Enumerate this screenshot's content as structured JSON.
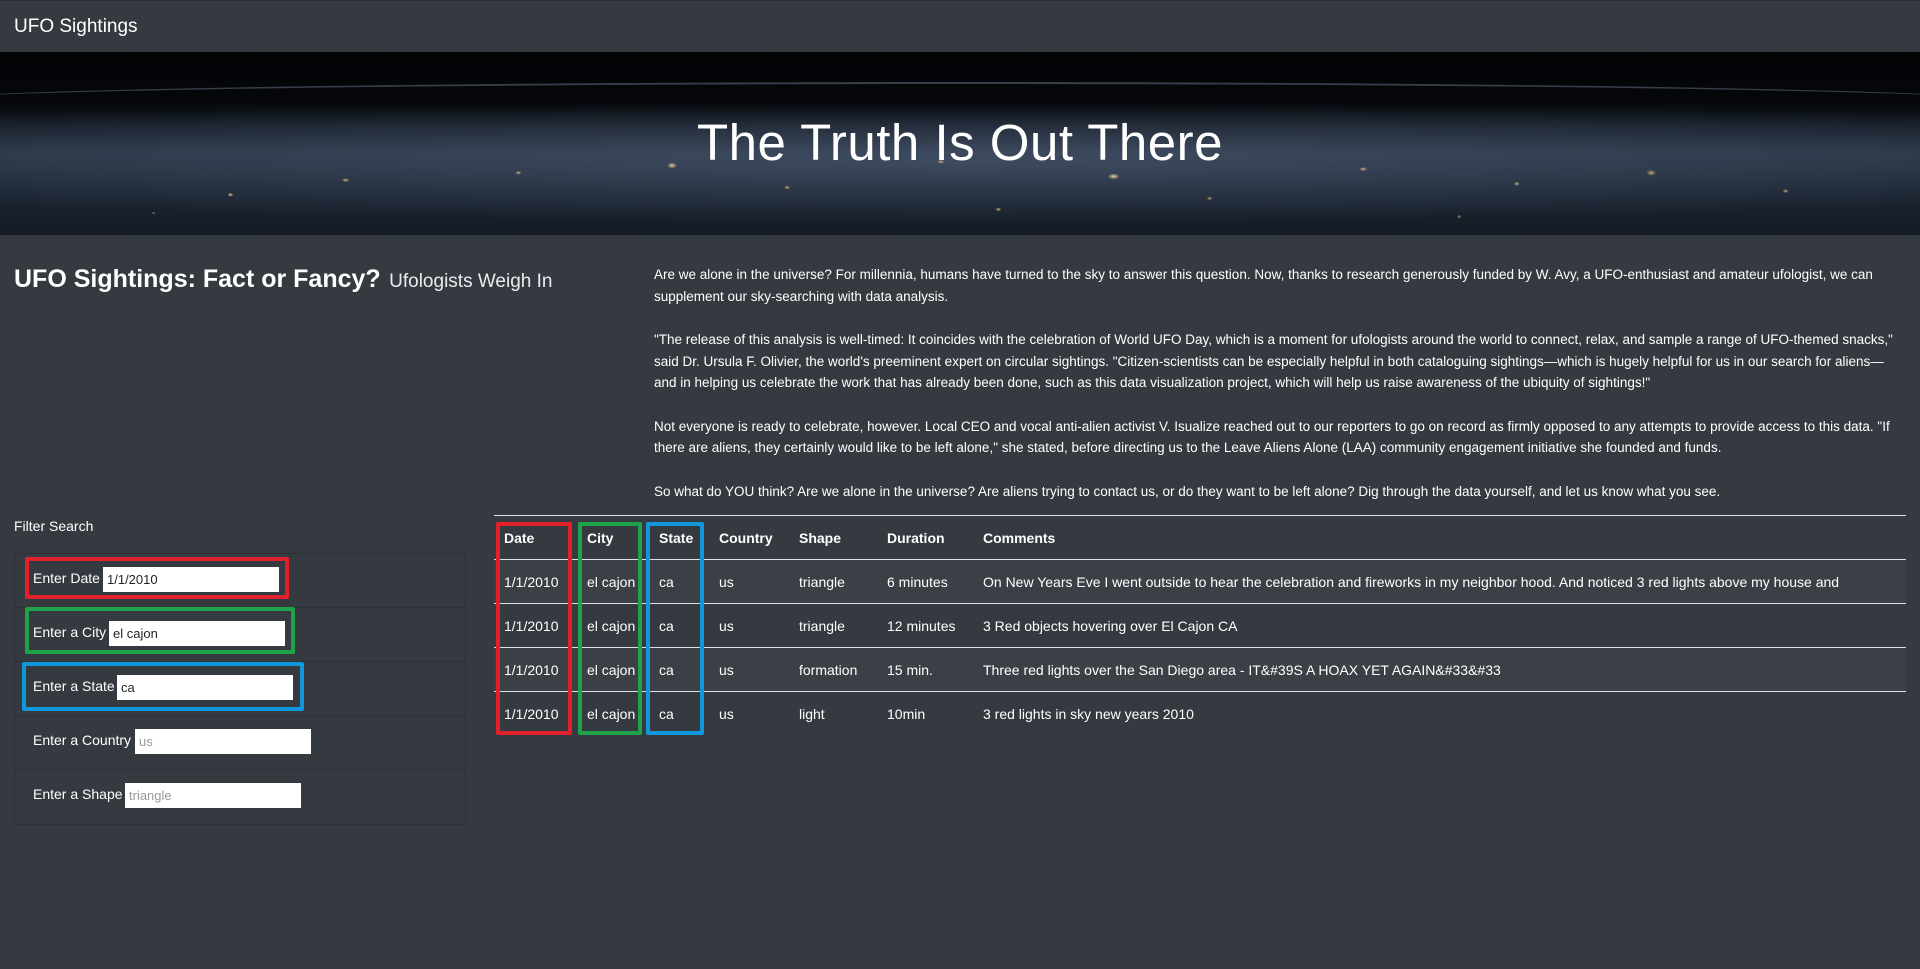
{
  "navbar": {
    "brand": "UFO Sightings"
  },
  "hero": {
    "title": "The Truth Is Out There"
  },
  "intro": {
    "heading": "UFO Sightings: Fact or Fancy?",
    "subheading": "Ufologists Weigh In",
    "paragraphs": [
      "Are we alone in the universe? For millennia, humans have turned to the sky to answer this question. Now, thanks to research generously funded by W. Avy, a UFO-enthusiast and amateur ufologist, we can supplement our sky-searching with data analysis.",
      "\"The release of this analysis is well-timed: It coincides with the celebration of World UFO Day, which is a moment for ufologists around the world to connect, relax, and sample a range of UFO-themed snacks,\" said Dr. Ursula F. Olivier, the world's preeminent expert on circular sightings. \"Citizen-scientists can be especially helpful in both cataloguing sightings—which is hugely helpful for us in our search for aliens—and in helping us celebrate the work that has already been done, such as this data visualization project, which will help us raise awareness of the ubiquity of sightings!\"",
      "Not everyone is ready to celebrate, however. Local CEO and vocal anti-alien activist V. Isualize reached out to our reporters to go on record as firmly opposed to any attempts to provide access to this data. \"If there are aliens, they certainly would like to be left alone,\" she stated, before directing us to the Leave Aliens Alone (LAA) community engagement initiative she founded and funds.",
      "So what do YOU think? Are we alone in the universe? Are aliens trying to contact us, or do they want to be left alone? Dig through the data yourself, and let us know what you see."
    ]
  },
  "filters": {
    "title": "Filter Search",
    "date": {
      "label": "Enter Date",
      "value": "1/1/2010",
      "placeholder": ""
    },
    "city": {
      "label": "Enter a City",
      "value": "el cajon",
      "placeholder": ""
    },
    "state": {
      "label": "Enter a State",
      "value": "ca",
      "placeholder": ""
    },
    "country": {
      "label": "Enter a Country",
      "value": "",
      "placeholder": "us"
    },
    "shape": {
      "label": "Enter a Shape",
      "value": "",
      "placeholder": "triangle"
    }
  },
  "table": {
    "headers": [
      "Date",
      "City",
      "State",
      "Country",
      "Shape",
      "Duration",
      "Comments"
    ],
    "rows": [
      [
        "1/1/2010",
        "el cajon",
        "ca",
        "us",
        "triangle",
        "6 minutes",
        "On New Years Eve I went outside to hear the celebration and fireworks in my neighbor hood. And noticed 3 red lights above my house and"
      ],
      [
        "1/1/2010",
        "el cajon",
        "ca",
        "us",
        "triangle",
        "12 minutes",
        "3 Red objects hovering over El Cajon CA"
      ],
      [
        "1/1/2010",
        "el cajon",
        "ca",
        "us",
        "formation",
        "15 min.",
        "Three red lights over the San Diego area - IT&#39S A HOAX YET AGAIN&#33&#33"
      ],
      [
        "1/1/2010",
        "el cajon",
        "ca",
        "us",
        "light",
        "10min",
        "3 red lights in sky new years 2010"
      ]
    ]
  },
  "colors": {
    "background": "#343a40",
    "highlight_red": "#e0202b",
    "highlight_green": "#1fa34a",
    "highlight_blue": "#1297dd"
  }
}
